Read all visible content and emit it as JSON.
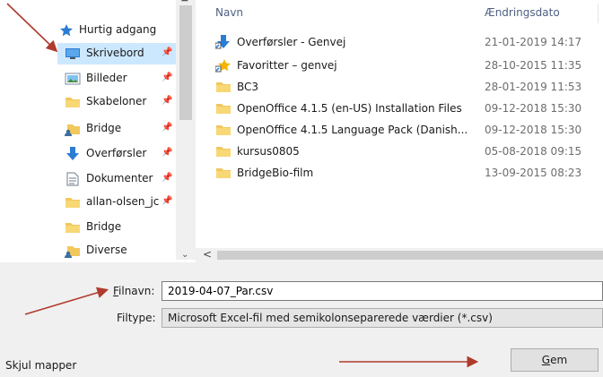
{
  "nav": {
    "top_item": "Hurtig adgang",
    "items": [
      {
        "label": "Skrivebord",
        "icon": "desktop-icon",
        "pinned": true,
        "selected": true
      },
      {
        "label": "Billeder",
        "icon": "pictures-icon",
        "pinned": true
      },
      {
        "label": "Skabeloner",
        "icon": "folder-icon",
        "pinned": true
      },
      {
        "label": "Bridge",
        "icon": "user-folder-icon",
        "pinned": true
      },
      {
        "label": "Overførsler",
        "icon": "download-icon",
        "pinned": true
      },
      {
        "label": "Dokumenter",
        "icon": "documents-icon",
        "pinned": true
      },
      {
        "label": "allan-olsen_jc",
        "icon": "folder-icon",
        "pinned": true
      },
      {
        "label": "Bridge",
        "icon": "folder-icon",
        "pinned": false
      },
      {
        "label": "Diverse",
        "icon": "user-folder-icon",
        "pinned": false
      }
    ]
  },
  "file_list": {
    "columns": {
      "name": "Navn",
      "date": "Ændringsdato"
    },
    "rows": [
      {
        "name": "Overførsler - Genvej",
        "date": "21-01-2019 14:17",
        "icon": "download-shortcut-icon"
      },
      {
        "name": "Favoritter – genvej",
        "date": "28-10-2015 11:35",
        "icon": "favorites-shortcut-icon"
      },
      {
        "name": "BC3",
        "date": "28-01-2019 11:53",
        "icon": "folder-icon"
      },
      {
        "name": "OpenOffice 4.1.5 (en-US) Installation Files",
        "date": "09-12-2018 15:30",
        "icon": "folder-icon"
      },
      {
        "name": "OpenOffice 4.1.5 Language Pack (Danish...",
        "date": "09-12-2018 15:30",
        "icon": "folder-icon"
      },
      {
        "name": "kursus0805",
        "date": "05-08-2018 09:15",
        "icon": "folder-icon"
      },
      {
        "name": "BridgeBio-film",
        "date": "13-09-2015 08:23",
        "icon": "folder-icon"
      }
    ]
  },
  "form": {
    "filename_label": "Filnavn:",
    "filename_value": "2019-04-07_Par.csv",
    "filetype_label": "Filtype:",
    "filetype_value": "Microsoft Excel-fil med semikolonseparerede værdier (*.csv)",
    "hide_folders": "Skjul mapper",
    "save_label": "Gem"
  },
  "colors": {
    "selected_bg": "#cce8ff",
    "folder": "#f2c75c",
    "header_text": "#4d6082",
    "annotation_arrow": "#b03a2e"
  }
}
